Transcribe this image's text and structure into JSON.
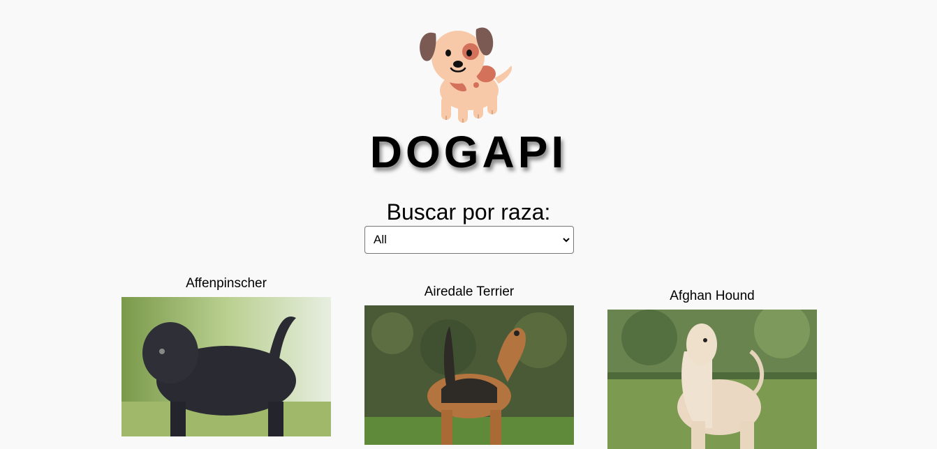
{
  "header": {
    "logo_icon": "dog-face-icon",
    "title": "DOGAPI"
  },
  "search": {
    "label": "Buscar por raza:",
    "selected": "All"
  },
  "breeds": [
    {
      "name": "Affenpinscher"
    },
    {
      "name": "Airedale Terrier"
    },
    {
      "name": "Afghan Hound"
    }
  ]
}
